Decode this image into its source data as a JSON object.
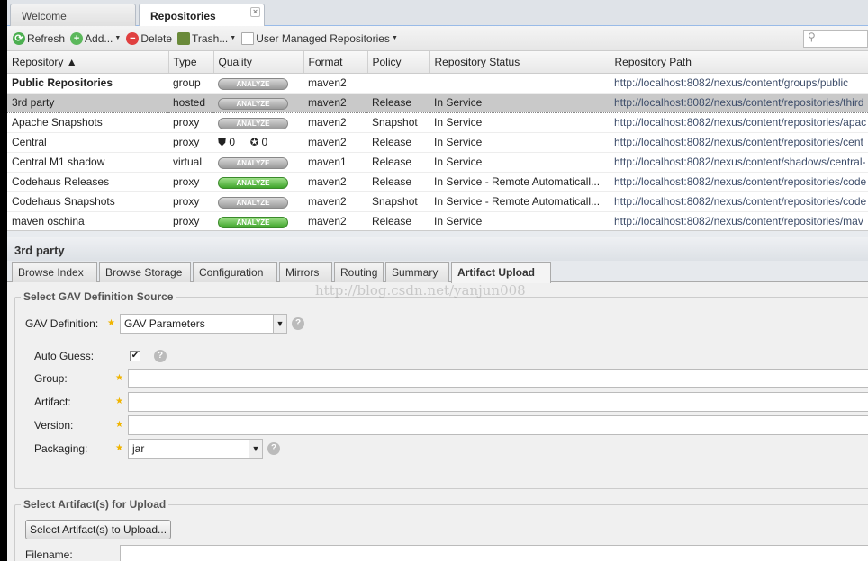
{
  "tabs": [
    {
      "label": "Welcome"
    },
    {
      "label": "Repositories"
    }
  ],
  "toolbar": {
    "refresh": "Refresh",
    "add": "Add...",
    "delete": "Delete",
    "trash": "Trash...",
    "user_managed": "User Managed Repositories"
  },
  "grid": {
    "columns": [
      "Repository ▲",
      "Type",
      "Quality",
      "Format",
      "Policy",
      "Repository Status",
      "Repository Path"
    ],
    "analyze_label": "ANALYZE",
    "rows": [
      {
        "name": "Public Repositories",
        "type": "group",
        "quality": "analyze",
        "format": "maven2",
        "policy": "",
        "status": "",
        "path": "http://localhost:8082/nexus/content/groups/public"
      },
      {
        "name": "3rd party",
        "type": "hosted",
        "quality": "analyze",
        "format": "maven2",
        "policy": "Release",
        "status": "In Service",
        "path": "http://localhost:8082/nexus/content/repositories/third"
      },
      {
        "name": "Apache Snapshots",
        "type": "proxy",
        "quality": "analyze",
        "format": "maven2",
        "policy": "Snapshot",
        "status": "In Service",
        "path": "http://localhost:8082/nexus/content/repositories/apac"
      },
      {
        "name": "Central",
        "type": "proxy",
        "quality": "counts",
        "shield_count": "0",
        "badge_count": "0",
        "format": "maven2",
        "policy": "Release",
        "status": "In Service",
        "path": "http://localhost:8082/nexus/content/repositories/cent"
      },
      {
        "name": "Central M1 shadow",
        "type": "virtual",
        "quality": "analyze",
        "format": "maven1",
        "policy": "Release",
        "status": "In Service",
        "path": "http://localhost:8082/nexus/content/shadows/central-"
      },
      {
        "name": "Codehaus Releases",
        "type": "proxy",
        "quality": "analyze-green",
        "format": "maven2",
        "policy": "Release",
        "status": "In Service - Remote Automaticall...",
        "path": "http://localhost:8082/nexus/content/repositories/code"
      },
      {
        "name": "Codehaus Snapshots",
        "type": "proxy",
        "quality": "analyze",
        "format": "maven2",
        "policy": "Snapshot",
        "status": "In Service - Remote Automaticall...",
        "path": "http://localhost:8082/nexus/content/repositories/code"
      },
      {
        "name": "maven oschina",
        "type": "proxy",
        "quality": "analyze-green",
        "format": "maven2",
        "policy": "Release",
        "status": "In Service",
        "path": "http://localhost:8082/nexus/content/repositories/mav"
      }
    ]
  },
  "detail": {
    "title": "3rd party",
    "tabs": [
      "Browse Index",
      "Browse Storage",
      "Configuration",
      "Mirrors",
      "Routing",
      "Summary",
      "Artifact Upload"
    ],
    "watermark": "http://blog.csdn.net/yanjun008",
    "gav": {
      "legend": "Select GAV Definition Source",
      "definition_label": "GAV Definition:",
      "definition_value": "GAV Parameters",
      "auto_guess_label": "Auto Guess:",
      "auto_guess": true,
      "group_label": "Group:",
      "artifact_label": "Artifact:",
      "version_label": "Version:",
      "packaging_label": "Packaging:",
      "packaging_value": "jar"
    },
    "upload": {
      "legend": "Select Artifact(s) for Upload",
      "button": "Select Artifact(s) to Upload...",
      "filename_label": "Filename:"
    }
  }
}
